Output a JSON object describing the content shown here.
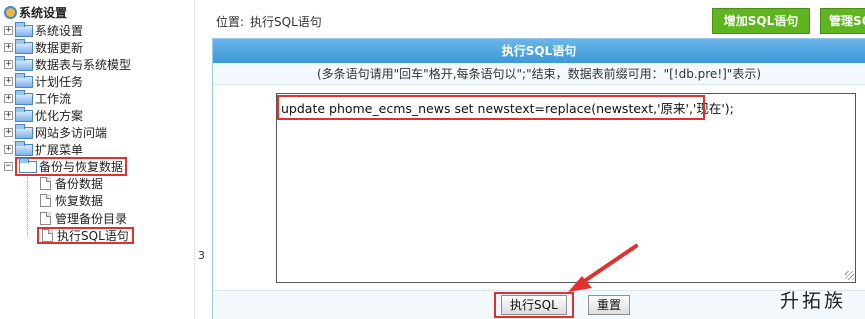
{
  "tree": {
    "root_label": "系统设置",
    "items": [
      {
        "label": "系统设置",
        "expanded": false
      },
      {
        "label": "数据更新",
        "expanded": false
      },
      {
        "label": "数据表与系统模型",
        "expanded": false
      },
      {
        "label": "计划任务",
        "expanded": false
      },
      {
        "label": "工作流",
        "expanded": false
      },
      {
        "label": "优化方案",
        "expanded": false
      },
      {
        "label": "网站多访问端",
        "expanded": false
      },
      {
        "label": "扩展菜单",
        "expanded": false
      },
      {
        "label": "备份与恢复数据",
        "expanded": true
      }
    ],
    "children": [
      "备份数据",
      "恢复数据",
      "管理备份目录",
      "执行SQL语句"
    ],
    "side_number": "3"
  },
  "topbar": {
    "location_label": "位置:",
    "location_value": "执行SQL语句",
    "add_sql_button": "增加SQL语句",
    "manage_sql_button": "管理SQL"
  },
  "panel": {
    "title": "执行SQL语句",
    "note": "(多条语句请用\"回车\"格开,每条语句以\";\"结束，数据表前缀可用：\"[!db.pre!]\"表示)",
    "sql_text": "update phome_ecms_news set newstext=replace(newstext,'原来','现在');",
    "exec_button": "执行SQL",
    "reset_button": "重置"
  },
  "watermark": "升拓族",
  "colors": {
    "green": "#5fb520",
    "header_blue": "#3d98d8",
    "highlight_red": "#e03131"
  }
}
